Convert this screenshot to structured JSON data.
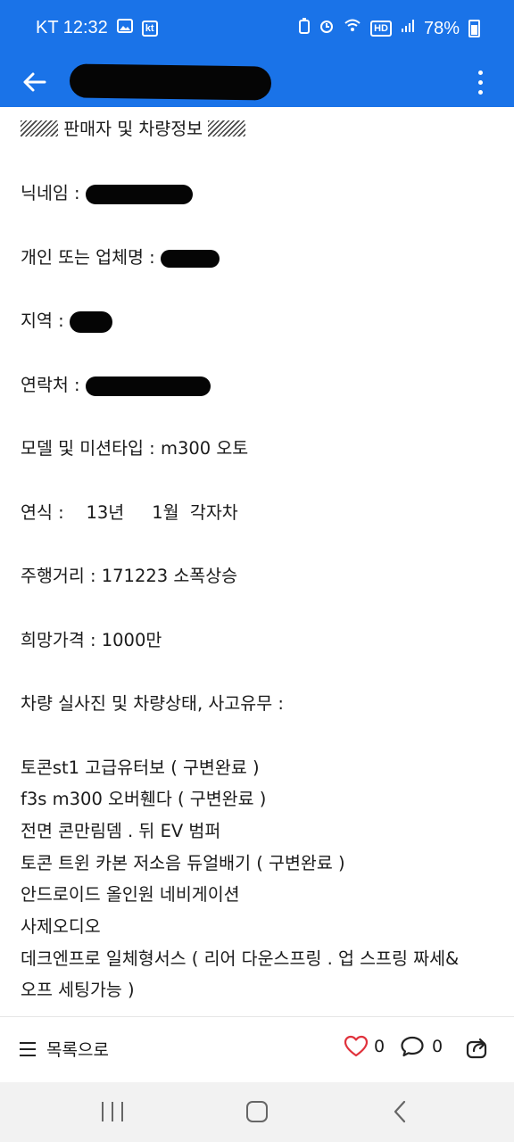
{
  "status_bar": {
    "carrier_time": "KT 12:32",
    "kt_badge": "kt",
    "hd_badge": "HD",
    "battery": "78%"
  },
  "app_bar": {
    "back_icon": "arrow-left-icon",
    "more_icon": "more-vertical-icon"
  },
  "post": {
    "heading": "판매자 및 차량정보",
    "nickname_label": "닉네임 :",
    "company_label": "개인 또는 업체명 :",
    "region_label": "지역 :",
    "contact_label": "연락처 :",
    "model_line": "모델 및 미션타입 : m300 오토",
    "year_line": "연식 :    13년     1월  각자차",
    "mileage_line": "주행거리 : 171223 소폭상승",
    "price_line": "희망가격 : 1000만",
    "photos_line": "차량 실사진 및 차량상태, 사고유무 :",
    "options": [
      "토콘st1 고급유터보 ( 구변완료 )",
      "f3s m300 오버휀다 ( 구변완료 )",
      "전면 콘만림뎀 . 뒤 EV 범퍼",
      "토콘 트윈 카본 저소음 듀얼배기 ( 구변완료 )",
      "안드로이드 올인원 네비게이션",
      "사제오디오",
      "데크엔프로 일체형서스 ( 리어 다운스프링 . 업 스프링 짜세&",
      "오프 세팅가능 )"
    ]
  },
  "bottom_bar": {
    "list_label": "목록으로",
    "like_count": "0",
    "comment_count": "0"
  },
  "colors": {
    "accent": "#1a73e8",
    "like": "#e0323c"
  }
}
